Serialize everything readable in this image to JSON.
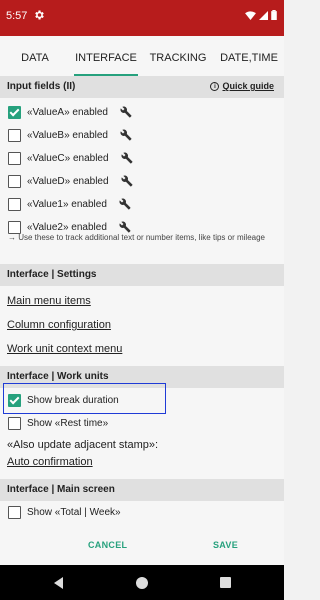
{
  "status": {
    "time": "5:57"
  },
  "tabs": [
    "DATA",
    "INTERFACE",
    "TRACKING",
    "DATE,TIME"
  ],
  "active_tab": "INTERFACE",
  "input_fields": {
    "header": "Input fields (II)",
    "quick_guide": "Quick guide",
    "items": [
      {
        "label": "«ValueA» enabled",
        "checked": true
      },
      {
        "label": "«ValueB» enabled",
        "checked": false
      },
      {
        "label": "«ValueC» enabled",
        "checked": false
      },
      {
        "label": "«ValueD» enabled",
        "checked": false
      },
      {
        "label": "«Value1» enabled",
        "checked": false
      },
      {
        "label": "«Value2» enabled",
        "checked": false
      }
    ],
    "hint": "→ Use these to track additional text or number items, like tips or mileage"
  },
  "settings": {
    "header": "Interface | Settings",
    "links": [
      "Main menu items",
      "Column configuration",
      "Work unit context menu"
    ]
  },
  "work_units": {
    "header": "Interface | Work units",
    "show_break": {
      "label": "Show break duration",
      "checked": true
    },
    "show_rest": {
      "label": "Show «Rest time»",
      "checked": false
    },
    "adjacent_label": "«Also update adjacent stamp»:",
    "adjacent_link": "Auto confirmation"
  },
  "main_screen": {
    "header": "Interface | Main screen",
    "show_total": {
      "label": "Show «Total | Week»",
      "checked": false
    }
  },
  "buttons": {
    "cancel": "CANCEL",
    "save": "SAVE"
  },
  "colors": {
    "status_bar": "#b71c1c",
    "accent": "#26a17d",
    "highlight": "#1f3bd6"
  }
}
